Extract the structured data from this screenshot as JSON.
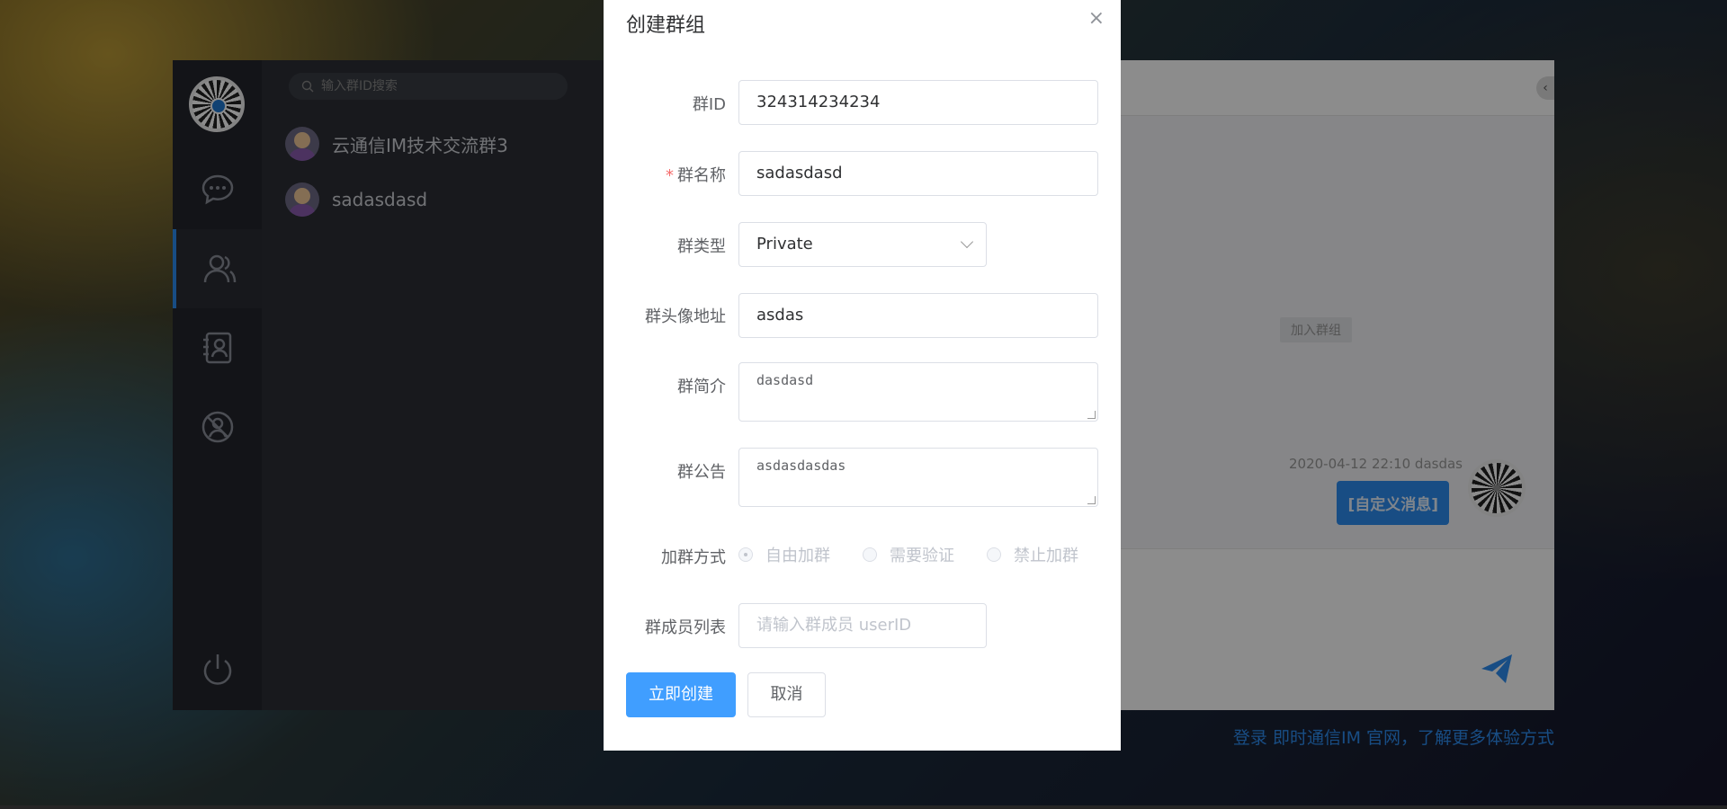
{
  "app": {
    "search_placeholder": "输入群ID搜索",
    "conversations": [
      {
        "name": "云通信IM技术交流群3"
      },
      {
        "name": "sadasdasd"
      }
    ],
    "chat": {
      "join_tip": "加入群组",
      "message_time": "2020-04-12 22:10 dasdas",
      "message_text": "[自定义消息]"
    },
    "footer_link": "登录 即时通信IM 官网，了解更多体验方式"
  },
  "modal": {
    "title": "创建群组",
    "close": "×",
    "fields": {
      "group_id": {
        "label": "群ID",
        "value": "324314234234"
      },
      "group_name": {
        "label": "群名称",
        "required_mark": "*",
        "value": "sadasdasd"
      },
      "group_type": {
        "label": "群类型",
        "value": "Private"
      },
      "avatar_url": {
        "label": "群头像地址",
        "value": "asdas"
      },
      "intro": {
        "label": "群简介",
        "value": "dasdasd"
      },
      "notice": {
        "label": "群公告",
        "value": "asdasdasdas"
      },
      "join_option": {
        "label": "加群方式",
        "options": [
          "自由加群",
          "需要验证",
          "禁止加群"
        ],
        "selected": "自由加群"
      },
      "members": {
        "label": "群成员列表",
        "placeholder": "请输入群成员 userID"
      }
    },
    "buttons": {
      "create": "立即创建",
      "cancel": "取消"
    }
  },
  "colors": {
    "primary": "#409eff",
    "sidebar": "#23262c",
    "required": "#f56c6c"
  }
}
